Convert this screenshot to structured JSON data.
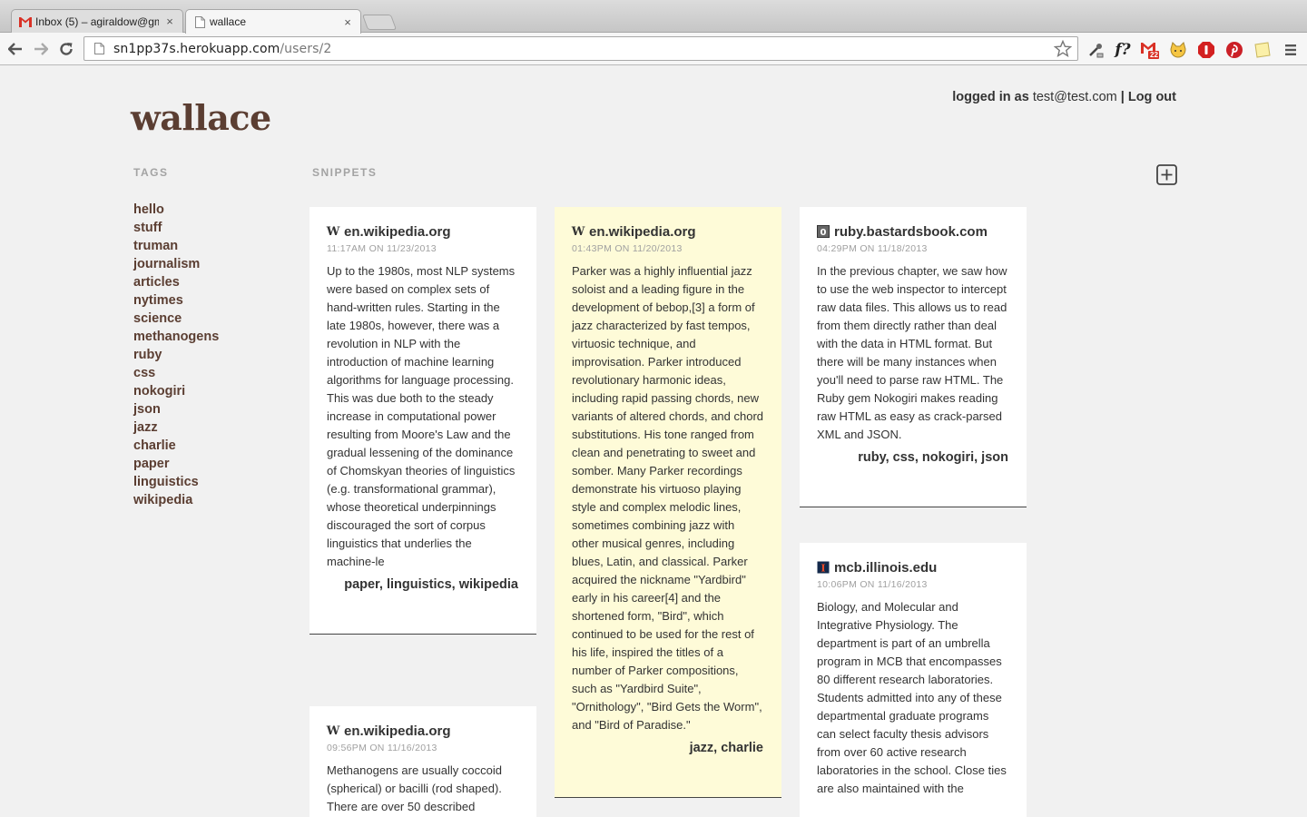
{
  "browser": {
    "tabs": [
      {
        "title": "Inbox (5) – agiraldow@gm",
        "icon": "gmail-icon",
        "active": false
      },
      {
        "title": "wallace",
        "icon": "document-icon",
        "active": true
      }
    ],
    "url_host": "sn1pp37s.herokuapp.com",
    "url_path": "/users/2",
    "gmail_badge": "22"
  },
  "header": {
    "brand": "wallace",
    "logged_in_prefix": "logged in as",
    "user_email": "test@test.com",
    "separator": "|",
    "logout_label": "Log out"
  },
  "tags_section": {
    "heading": "TAGS",
    "items": [
      "hello",
      "stuff",
      "truman",
      "journalism",
      "articles",
      "nytimes",
      "science",
      "methanogens",
      "ruby",
      "css",
      "nokogiri",
      "json",
      "jazz",
      "charlie",
      "paper",
      "linguistics",
      "wikipedia"
    ]
  },
  "snippets_section": {
    "heading": "SNIPPETS",
    "cards": [
      {
        "source": "en.wikipedia.org",
        "favicon": "W",
        "time": "11:17AM ON 11/23/2013",
        "body": "Up to the 1980s, most NLP systems were based on complex sets of hand-written rules. Starting in the late 1980s, however, there was a revolution in NLP with the introduction of machine learning algorithms for language processing. This was due both to the steady increase in computational power resulting from Moore's Law and the gradual lessening of the dominance of Chomskyan theories of linguistics (e.g. transformational grammar), whose theoretical underpinnings discouraged the sort of corpus linguistics that underlies the machine-le",
        "tags": "paper, linguistics, wikipedia"
      },
      {
        "source": "en.wikipedia.org",
        "favicon": "W",
        "time": "01:43PM ON 11/20/2013",
        "body": "Parker was a highly influential jazz soloist and a leading figure in the development of bebop,[3] a form of jazz characterized by fast tempos, virtuosic technique, and improvisation. Parker introduced revolutionary harmonic ideas, including rapid passing chords, new variants of altered chords, and chord substitutions. His tone ranged from clean and penetrating to sweet and somber. Many Parker recordings demonstrate his virtuoso playing style and complex melodic lines, sometimes combining jazz with other musical genres, including blues, Latin, and classical. Parker acquired the nickname \"Yardbird\" early in his career[4] and the shortened form, \"Bird\", which continued to be used for the rest of his life, inspired the titles of a number of Parker compositions, such as \"Yardbird Suite\", \"Ornithology\", \"Bird Gets the Worm\", and \"Bird of Paradise.\"",
        "tags": "jazz, charlie"
      },
      {
        "source": "ruby.bastardsbook.com",
        "favicon": "0",
        "time": "04:29PM ON 11/18/2013",
        "body": "In the previous chapter, we saw how to use the web inspector to intercept raw data files. This allows us to read from them directly rather than deal with the data in HTML format. But there will be many instances when you'll need to parse raw HTML. The Ruby gem Nokogiri makes reading raw HTML as easy as crack-parsed XML and JSON.",
        "tags": "ruby, css, nokogiri, json"
      },
      {
        "source": "en.wikipedia.org",
        "favicon": "W",
        "time": "09:56PM ON 11/16/2013",
        "body": "Methanogens are usually coccoid (spherical) or bacilli (rod shaped). There are over 50 described",
        "tags": ""
      },
      {
        "source": "mcb.illinois.edu",
        "favicon": "I",
        "time": "10:06PM ON 11/16/2013",
        "body": "Biology, and Molecular and Integrative Physiology. The department is part of an umbrella program in MCB that encompasses 80 different research laboratories. Students admitted into any of these departmental graduate programs can select faculty thesis advisors from over 60 active research laboratories in the school. Close ties are also maintained with the",
        "tags": ""
      }
    ]
  },
  "colors": {
    "brand": "#5b3e32",
    "highlight_card": "#fefbd8",
    "page_bg": "#f1f1f1"
  }
}
